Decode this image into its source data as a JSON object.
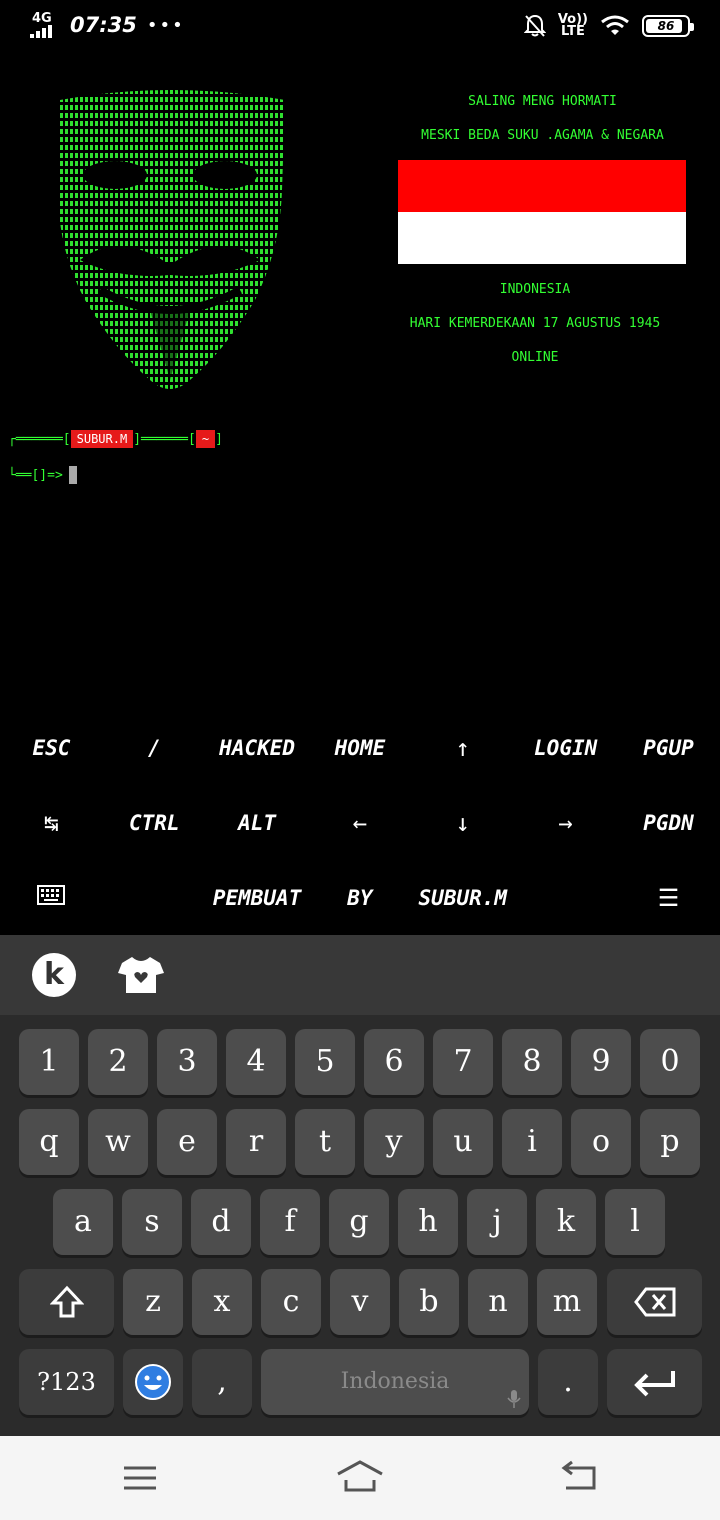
{
  "status_bar": {
    "network": "4G",
    "time": "07:35",
    "more": "•••",
    "volte_top": "Vo))",
    "volte_bottom": "LTE",
    "battery": "86"
  },
  "terminal": {
    "banner_lines_top": [
      "SALING MENG HORMATI",
      "MESKI BEDA SUKU .AGAMA & NEGARA"
    ],
    "banner_lines_bottom": [
      "INDONESIA",
      "HARI KEMERDEKAAN 17 AGUSTUS 1945",
      "ONLINE"
    ],
    "flag_colors": {
      "top": "#ff0000",
      "bottom": "#ffffff"
    },
    "prompt": {
      "line1_prefix": "┌══════[",
      "user": "SUBUR.M",
      "line1_mid": "]══════[",
      "dir": "~",
      "line1_end": "]",
      "line2": "└══[]=>"
    },
    "accent_color": "#33ff33"
  },
  "extra_keys": {
    "row1": [
      "ESC",
      "/",
      "HACKED",
      "HOME",
      "↑",
      "LOGIN",
      "PGUP"
    ],
    "row2": [
      "↹",
      "CTRL",
      "ALT",
      "←",
      "↓",
      "→",
      "PGDN"
    ],
    "row3": [
      "keyboard-icon",
      "",
      "PEMBUAT",
      "BY",
      "SUBUR.M",
      "",
      "☰"
    ]
  },
  "keyboard": {
    "number_row": [
      "1",
      "2",
      "3",
      "4",
      "5",
      "6",
      "7",
      "8",
      "9",
      "0"
    ],
    "row_q": [
      "q",
      "w",
      "e",
      "r",
      "t",
      "y",
      "u",
      "i",
      "o",
      "p"
    ],
    "row_a": [
      "a",
      "s",
      "d",
      "f",
      "g",
      "h",
      "j",
      "k",
      "l"
    ],
    "row_z": [
      "z",
      "x",
      "c",
      "v",
      "b",
      "n",
      "m"
    ],
    "symbols_label": "?123",
    "comma": ",",
    "period": ".",
    "space_label": "Indonesia"
  }
}
